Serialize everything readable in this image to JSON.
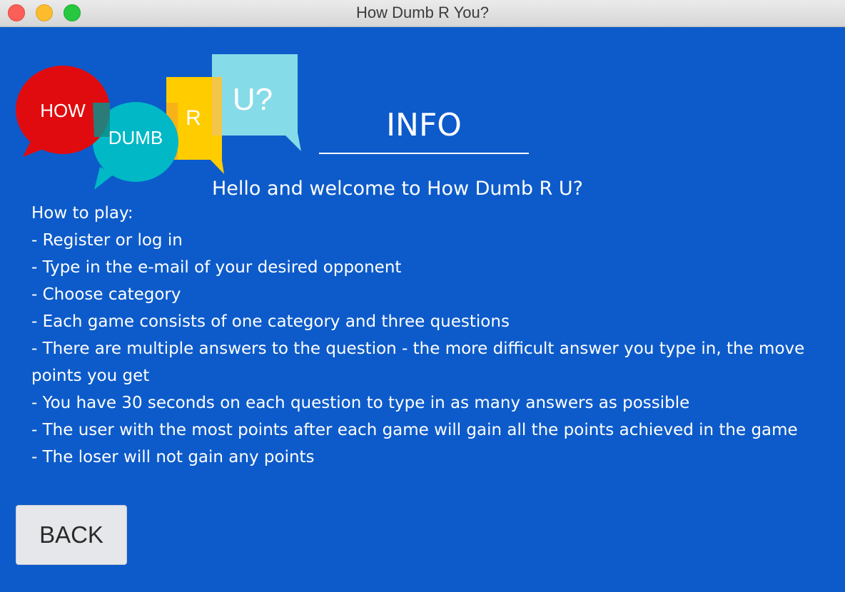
{
  "window": {
    "title": "How Dumb R You?"
  },
  "logo": {
    "bubble_1": "HOW",
    "bubble_2": "DUMB",
    "bubble_3": "R",
    "bubble_4": "U?",
    "colors": {
      "how": "#e00b0e",
      "dumb": "#00b8c6",
      "r": "#ffcc00",
      "u": "#86dbe8"
    }
  },
  "header": {
    "title": "INFO",
    "welcome": "Hello and welcome to How Dumb R U?"
  },
  "instructions": {
    "lines": [
      "How to play:",
      "- Register or log in",
      "- Type in the e-mail of your desired opponent",
      "- Choose category",
      "- Each game consists of one category and three questions",
      "- There are multiple answers to the question - the more difficult answer you type in, the move points you get",
      "- You have 30 seconds on each question to type in as many answers as possible",
      "- The user with the most points after each game will gain all the points achieved in the game",
      "- The loser will not gain any points"
    ]
  },
  "actions": {
    "back_label": "BACK"
  },
  "colors": {
    "background": "#0d5bca",
    "text": "#ffffff",
    "button_bg": "#e6e7ea"
  }
}
